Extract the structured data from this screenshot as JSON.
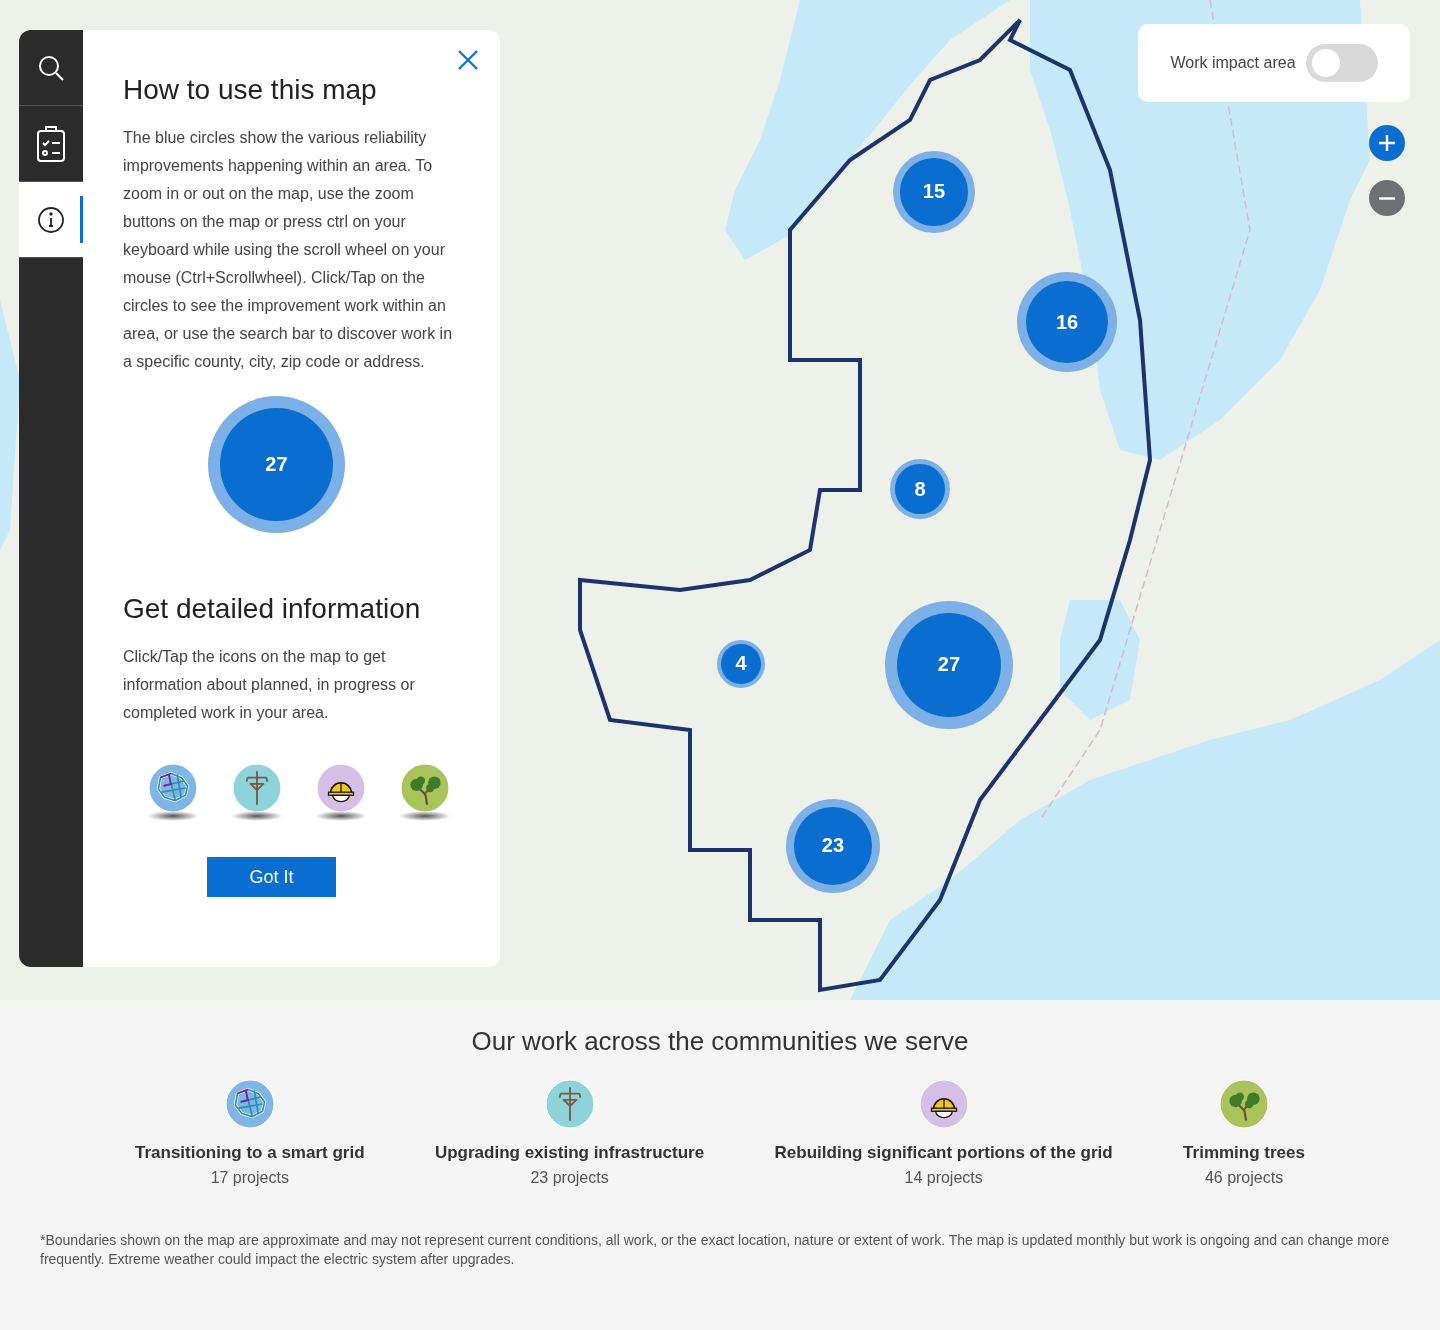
{
  "map": {
    "clusters": [
      {
        "count": "15"
      },
      {
        "count": "16"
      },
      {
        "count": "8"
      },
      {
        "count": "27"
      },
      {
        "count": "4"
      },
      {
        "count": "23"
      }
    ],
    "layer_toggle": {
      "label": "Work impact area",
      "on": false
    }
  },
  "sidebar": {
    "tabs": [
      {
        "kind": "search",
        "selected": false
      },
      {
        "kind": "checklist",
        "selected": false
      },
      {
        "kind": "info",
        "selected": true
      }
    ]
  },
  "panel": {
    "title": "How to use this map",
    "intro": "The blue circles show the various reliability improvements happening within an area. To zoom in or out on the map, use the zoom buttons on the map or press ctrl on your keyboard while using the scroll wheel on your mouse (Ctrl+Scrollwheel). Click/Tap on the circles to see the improvement work within an area, or use the search bar to discover work in a specific county, city, zip code or address.",
    "sample_cluster": "27",
    "subtitle": "Get detailed information",
    "details": "Click/Tap the icons on the map to get information about planned, in progress or completed work in your area.",
    "icons": [
      {
        "kind": "grid"
      },
      {
        "kind": "pole"
      },
      {
        "kind": "hardhat"
      },
      {
        "kind": "trees"
      }
    ],
    "button": "Got It"
  },
  "summary": {
    "title": "Our work across the communities we serve",
    "categories": [
      {
        "kind": "grid",
        "name": "Transitioning to a smart grid",
        "count": "17 projects"
      },
      {
        "kind": "pole",
        "name": "Upgrading existing infrastructure",
        "count": "23 projects"
      },
      {
        "kind": "hardhat",
        "name": "Rebuilding significant portions of the grid",
        "count": "14 projects"
      },
      {
        "kind": "trees",
        "name": "Trimming trees",
        "count": "46 projects"
      }
    ],
    "footnote": "*Boundaries shown on the map are approximate and may not represent current conditions, all work, or the exact location, nature or extent of work. The map is updated monthly but work is ongoing and can change more frequently. Extreme weather could impact the electric system after upgrades."
  }
}
